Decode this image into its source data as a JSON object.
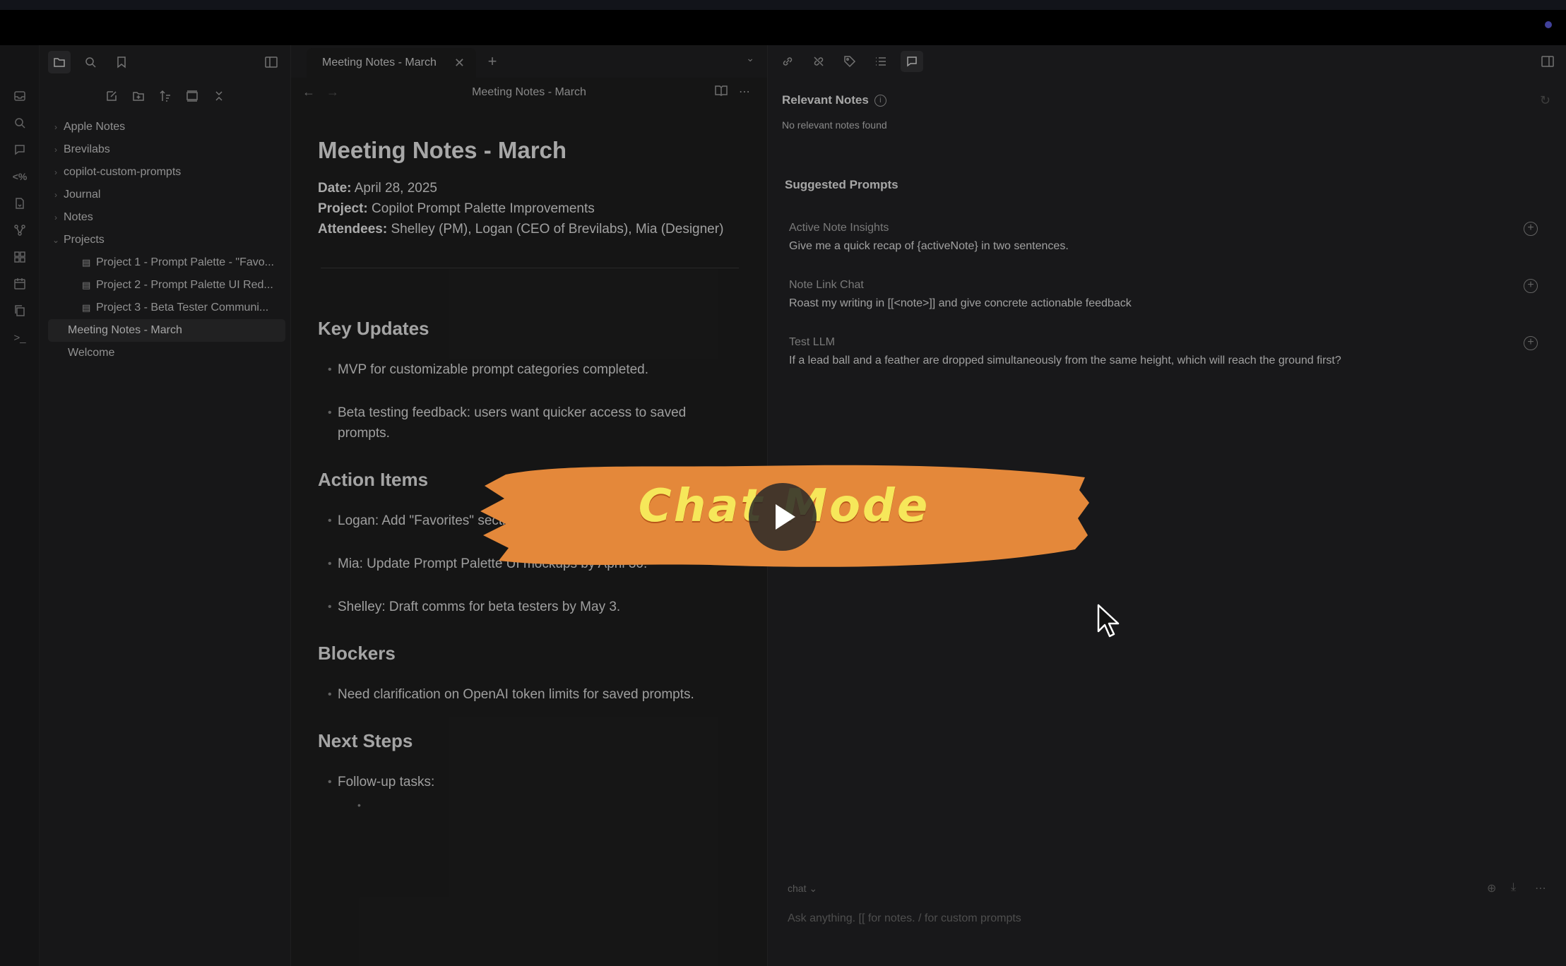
{
  "sidebar": {
    "items": [
      {
        "label": "Apple Notes",
        "type": "folder"
      },
      {
        "label": "Brevilabs",
        "type": "folder"
      },
      {
        "label": "copilot-custom-prompts",
        "type": "folder"
      },
      {
        "label": "Journal",
        "type": "folder"
      },
      {
        "label": "Notes",
        "type": "folder"
      },
      {
        "label": "Projects",
        "type": "folder",
        "expanded": true
      },
      {
        "label": "Project 1 - Prompt Palette - \"Favo...",
        "type": "file"
      },
      {
        "label": "Project 2 - Prompt Palette UI Red...",
        "type": "file"
      },
      {
        "label": "Project 3 - Beta Tester Communi...",
        "type": "file"
      },
      {
        "label": "Meeting Notes - March",
        "type": "file",
        "selected": true
      },
      {
        "label": "Welcome",
        "type": "file"
      }
    ]
  },
  "editor": {
    "tab_label": "Meeting Notes - March",
    "header_title": "Meeting Notes - March",
    "doc": {
      "title": "Meeting Notes - March",
      "date_label": "Date:",
      "date_value": "April 28, 2025",
      "project_label": "Project:",
      "project_value": "Copilot Prompt Palette Improvements",
      "attendees_label": "Attendees:",
      "attendees_value": "Shelley (PM), Logan (CEO of Brevilabs), Mia (Designer)",
      "key_updates": {
        "heading": "Key Updates",
        "items": [
          "MVP for customizable prompt categories completed.",
          "Beta testing feedback: users want quicker access to saved prompts."
        ]
      },
      "action_items": {
        "heading": "Action Items",
        "items": [
          "Logan: Add \"Favorites\" section",
          "Mia: Update Prompt Palette UI mockups by April 30.",
          "Shelley: Draft comms for beta testers by May 3."
        ]
      },
      "blockers": {
        "heading": "Blockers",
        "items": [
          "Need clarification on OpenAI token limits for saved prompts."
        ]
      },
      "next_steps": {
        "heading": "Next Steps",
        "items": [
          "Follow-up tasks:"
        ]
      }
    }
  },
  "right_pane": {
    "relevant_notes_title": "Relevant Notes",
    "relevant_notes_empty": "No relevant notes found",
    "suggested_prompts_title": "Suggested Prompts",
    "prompts": [
      {
        "title": "Active Note Insights",
        "body": "Give me a quick recap of {activeNote} in two sentences."
      },
      {
        "title": "Note Link Chat",
        "body": "Roast my writing in [[<note>]] and give concrete actionable feedback"
      },
      {
        "title": "Test LLM",
        "body": "If a lead ball and a feather are dropped simultaneously from the same height, which will reach the ground first?"
      }
    ],
    "chat_mode": "chat",
    "chat_placeholder": "Ask anything. [[ for notes. / for custom prompts"
  },
  "banner": {
    "text": "Chat Mode",
    "color_fill": "#e4883a",
    "color_text": "#f6e75a"
  }
}
